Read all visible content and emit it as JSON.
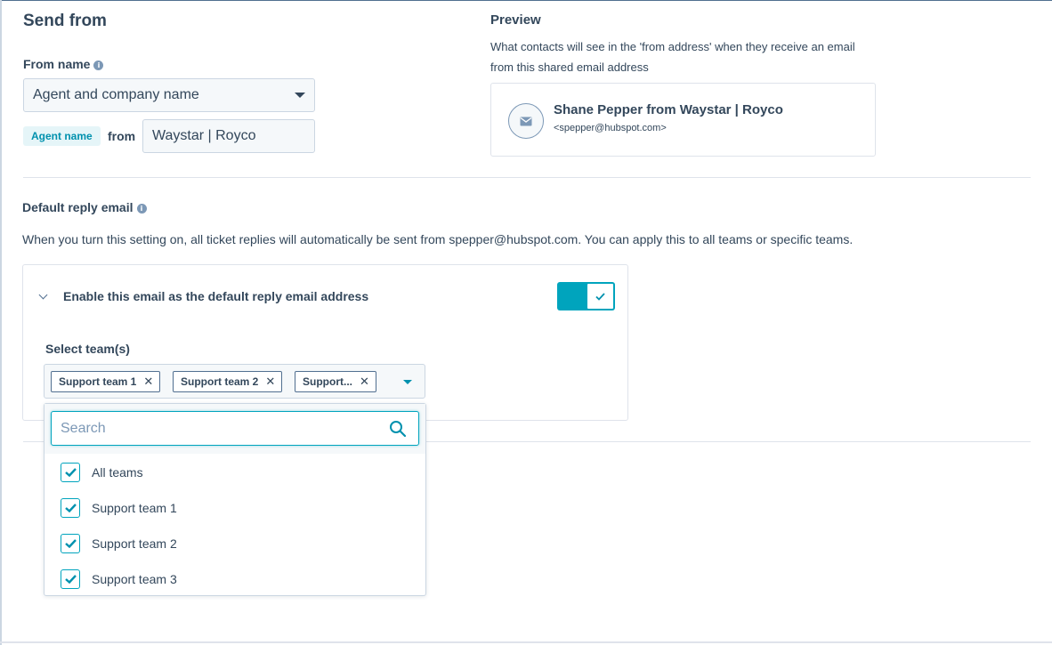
{
  "send_from": {
    "title": "Send from",
    "from_name_label": "From name",
    "from_name_select_value": "Agent and company name",
    "agent_token": "Agent name",
    "from_word": "from",
    "company_value": "Waystar | Royco"
  },
  "preview": {
    "title": "Preview",
    "description": "What contacts will see in the 'from address' when they receive an email from this shared email address",
    "sender_name": "Shane Pepper from Waystar | Royco",
    "sender_email": "<spepper@hubspot.com>",
    "avatar_icon": "email-envelope-icon"
  },
  "default_reply": {
    "title": "Default reply email",
    "description": "When you turn this setting on, all ticket replies will automatically be sent from spepper@hubspot.com. You can apply this to all teams or specific teams.",
    "enable_label": "Enable this email as the default reply email address",
    "toggle_on": true,
    "select_teams_label": "Select team(s)",
    "selected_chips": [
      "Support team 1",
      "Support team 2",
      "Support..."
    ],
    "search_placeholder": "Search",
    "options": [
      {
        "label": "All teams",
        "checked": true
      },
      {
        "label": "Support team 1",
        "checked": true
      },
      {
        "label": "Support team 2",
        "checked": true
      },
      {
        "label": "Support team 3",
        "checked": true
      }
    ]
  },
  "colors": {
    "accent": "#00a4bd",
    "text": "#33475b",
    "border": "#cbd6e2"
  }
}
